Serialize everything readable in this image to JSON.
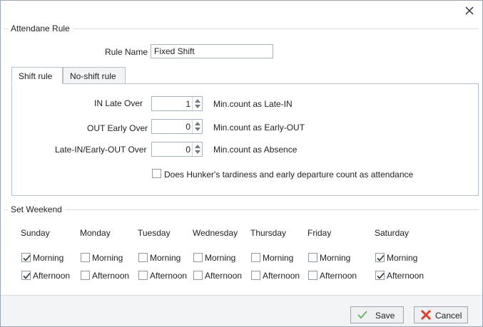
{
  "rule_group": {
    "title": "Attendane Rule",
    "rule_name_label": "Rule Name",
    "rule_name_value": "Fixed Shift"
  },
  "tabs": [
    {
      "label": "Shift rule",
      "active": true
    },
    {
      "label": "No-shift rule",
      "active": false
    }
  ],
  "shift_rule": {
    "rows": [
      {
        "label": "IN Late Over",
        "value": "1",
        "suffix": "Min.count as Late-IN"
      },
      {
        "label": "OUT Early Over",
        "value": "0",
        "suffix": "Min.count as Early-OUT"
      },
      {
        "label": "Late-IN/Early-OUT Over",
        "value": "0",
        "suffix": "Min.count as Absence"
      }
    ],
    "tardiness_checkbox_label": "Does Hunker's tardiness and early departure count as attendance",
    "tardiness_checked": false
  },
  "weekend": {
    "title": "Set Weekend",
    "morning_label": "Morning",
    "afternoon_label": "Afternoon",
    "days": [
      {
        "name": "Sunday",
        "morning": true,
        "afternoon": true
      },
      {
        "name": "Monday",
        "morning": false,
        "afternoon": false
      },
      {
        "name": "Tuesday",
        "morning": false,
        "afternoon": false
      },
      {
        "name": "Wednesday",
        "morning": false,
        "afternoon": false
      },
      {
        "name": "Thursday",
        "morning": false,
        "afternoon": false
      },
      {
        "name": "Friday",
        "morning": false,
        "afternoon": false
      },
      {
        "name": "Saturday",
        "morning": true,
        "afternoon": true
      }
    ]
  },
  "footer": {
    "save_label": "Save",
    "cancel_label": "Cancel"
  },
  "colors": {
    "save_icon": "#6bb86b",
    "cancel_icon": "#d9412e"
  },
  "icons": {
    "close": "close-icon",
    "save": "checkmark-icon",
    "cancel": "cross-icon"
  }
}
